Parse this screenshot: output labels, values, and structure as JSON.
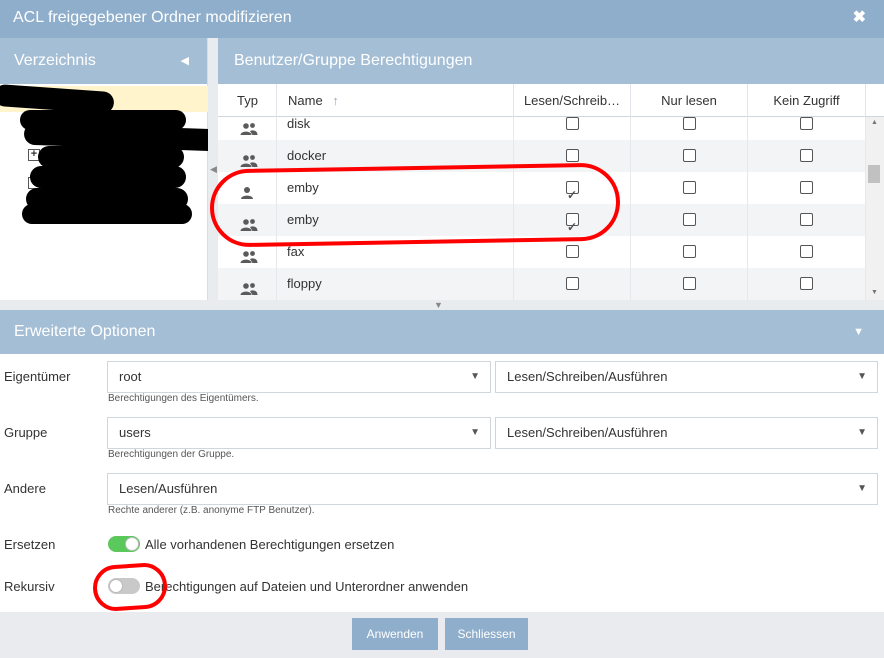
{
  "dialog": {
    "title": "ACL freigegebener Ordner modifizieren",
    "close_glyph": "✖"
  },
  "left_panel": {
    "title": "Verzeichnis",
    "collapse_glyph": "◀"
  },
  "right_panel": {
    "title": "Benutzer/Gruppe Berechtigungen",
    "columns": {
      "type": "Typ",
      "name": "Name",
      "sort_glyph": "↑",
      "rw": "Lesen/Schreib…",
      "ro": "Nur lesen",
      "none": "Kein Zugriff"
    },
    "rows": [
      {
        "name": "disk",
        "icon": "group-icon",
        "rw": false,
        "ro": false,
        "none": false
      },
      {
        "name": "docker",
        "icon": "group-icon",
        "rw": false,
        "ro": false,
        "none": false
      },
      {
        "name": "emby",
        "icon": "user-icon",
        "rw": true,
        "ro": false,
        "none": false
      },
      {
        "name": "emby",
        "icon": "group-icon",
        "rw": true,
        "ro": false,
        "none": false
      },
      {
        "name": "fax",
        "icon": "group-icon",
        "rw": false,
        "ro": false,
        "none": false
      },
      {
        "name": "floppy",
        "icon": "group-icon",
        "rw": false,
        "ro": false,
        "none": false
      }
    ]
  },
  "advanced": {
    "title": "Erweiterte Optionen",
    "toggle_glyph": "▼",
    "owner": {
      "label": "Eigentümer",
      "user": "root",
      "permission": "Lesen/Schreiben/Ausführen",
      "hint": "Berechtigungen des Eigentümers."
    },
    "group": {
      "label": "Gruppe",
      "group": "users",
      "permission": "Lesen/Schreiben/Ausführen",
      "hint": "Berechtigungen der Gruppe."
    },
    "others": {
      "label": "Andere",
      "permission": "Lesen/Ausführen",
      "hint": "Rechte anderer (z.B. anonyme FTP Benutzer)."
    },
    "replace": {
      "label": "Ersetzen",
      "enabled": true,
      "text": "Alle vorhandenen Berechtigungen ersetzen"
    },
    "recursive": {
      "label": "Rekursiv",
      "enabled": false,
      "text": "Berechtigungen auf Dateien und Unterordner anwenden"
    }
  },
  "footer": {
    "apply_label": "Anwenden",
    "close_label": "Schliessen"
  },
  "colors": {
    "header_blue": "#a4bed6",
    "title_blue": "#8faecb",
    "toggle_on": "#5bc85b",
    "annotation_red": "#ff0000"
  }
}
